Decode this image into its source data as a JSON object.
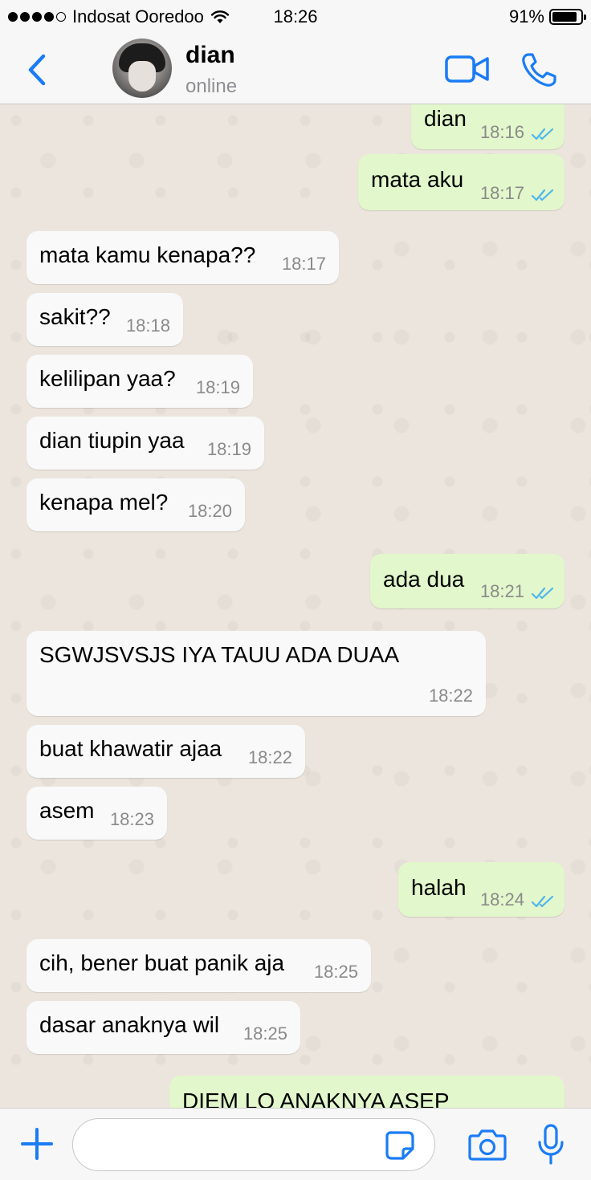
{
  "status_bar": {
    "carrier": "Indosat Ooredoo",
    "time": "18:26",
    "battery": "91%",
    "signal_icon": "signal-dots-icon",
    "wifi_icon": "wifi-icon",
    "battery_icon": "battery-icon"
  },
  "header": {
    "contact_name": "dian",
    "contact_status": "online",
    "back_icon": "chevron-left-icon",
    "video_icon": "video-camera-icon",
    "call_icon": "phone-icon"
  },
  "messages": [
    {
      "dir": "out",
      "text": "dian",
      "time": "18:16",
      "read": true
    },
    {
      "dir": "out",
      "text": "mata aku",
      "time": "18:17",
      "read": true
    },
    {
      "dir": "in",
      "text": "mata kamu kenapa??",
      "time": "18:17"
    },
    {
      "dir": "in",
      "text": "sakit??",
      "time": "18:18"
    },
    {
      "dir": "in",
      "text": "kelilipan yaa?",
      "time": "18:19"
    },
    {
      "dir": "in",
      "text": "dian tiupin yaa",
      "time": "18:19"
    },
    {
      "dir": "in",
      "text": "kenapa mel?",
      "time": "18:20"
    },
    {
      "dir": "out",
      "text": "ada dua",
      "time": "18:21",
      "read": true
    },
    {
      "dir": "in",
      "text": "SGWJSVSJS IYA TAUU ADA DUAA",
      "time": "18:22"
    },
    {
      "dir": "in",
      "text": "buat khawatir ajaa",
      "time": "18:22"
    },
    {
      "dir": "in",
      "text": "asem",
      "time": "18:23"
    },
    {
      "dir": "out",
      "text": "halah",
      "time": "18:24",
      "read": true
    },
    {
      "dir": "in",
      "text": "cih, bener buat panik aja",
      "time": "18:25"
    },
    {
      "dir": "in",
      "text": "dasar anaknya wil",
      "time": "18:25"
    },
    {
      "dir": "out",
      "text": "DIEM LO ANAKNYA ASEP",
      "time": "",
      "read": true
    }
  ],
  "colors": {
    "accent": "#1a7cf5",
    "incoming_bubble": "#f9f9f9",
    "outgoing_bubble": "#e2f7cb",
    "read_ticks": "#4fb6ec",
    "chat_background": "#ece5dd"
  },
  "input_bar": {
    "placeholder": "",
    "plus_icon": "plus-icon",
    "sticker_icon": "sticker-icon",
    "camera_icon": "camera-icon",
    "mic_icon": "microphone-icon"
  }
}
